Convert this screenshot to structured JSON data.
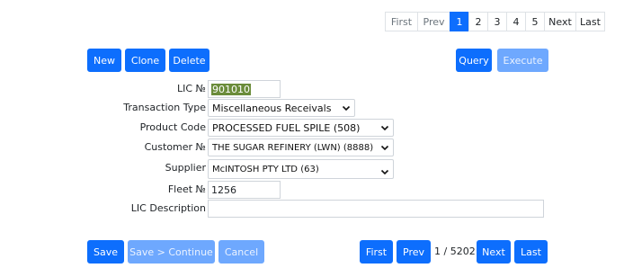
{
  "pager_top": {
    "first": "First",
    "prev": "Prev",
    "pages": [
      "1",
      "2",
      "3",
      "4",
      "5"
    ],
    "next": "Next",
    "last": "Last"
  },
  "actions": {
    "new": "New",
    "clone": "Clone",
    "delete": "Delete",
    "query": "Query",
    "execute": "Execute"
  },
  "form": {
    "lic_no_label": "LIC №",
    "lic_no_value": "901010",
    "transaction_type_label": "Transaction Type",
    "transaction_type_value": "Miscellaneous Receivals",
    "product_code_label": "Product Code",
    "product_code_value": "PROCESSED FUEL SPILE (508)",
    "customer_no_label": "Customer №",
    "customer_no_value": "THE SUGAR REFINERY (LWN) (8888)",
    "supplier_label": "Supplier",
    "supplier_value": "McINTOSH PTY LTD (63)",
    "fleet_no_label": "Fleet №",
    "fleet_no_value": "1256",
    "lic_description_label": "LIC Description",
    "lic_description_value": ""
  },
  "footer": {
    "save": "Save",
    "save_continue": "Save > Continue",
    "cancel": "Cancel",
    "first": "First",
    "prev": "Prev",
    "record_count": "1 / 5202",
    "next": "Next",
    "last": "Last"
  },
  "colors": {
    "primary": "#0d6efd",
    "primary_disabled": "#6ea8fe",
    "selection_highlight": "#6b8c3a"
  },
  "icons": {
    "dropdown": "chevron-down-icon"
  }
}
